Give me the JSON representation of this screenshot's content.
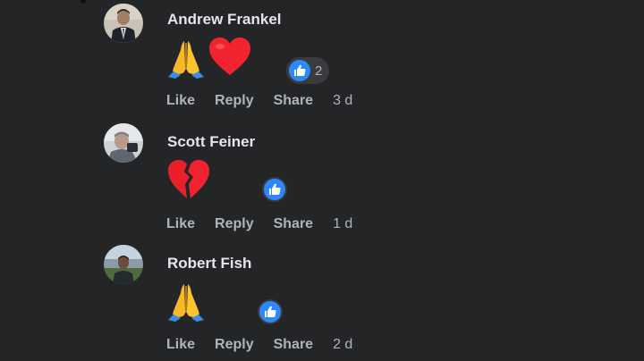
{
  "comments": [
    {
      "author": "Andrew Frankel",
      "emoji_names": [
        "folded-hands-icon",
        "red-heart-icon"
      ],
      "like_count": "2",
      "actions": {
        "like": "Like",
        "reply": "Reply",
        "share": "Share"
      },
      "time": "3 d"
    },
    {
      "author": "Scott Feiner",
      "emoji_names": [
        "broken-heart-icon"
      ],
      "like_count": "",
      "actions": {
        "like": "Like",
        "reply": "Reply",
        "share": "Share"
      },
      "time": "1 d"
    },
    {
      "author": "Robert Fish",
      "emoji_names": [
        "folded-hands-icon"
      ],
      "like_count": "",
      "actions": {
        "like": "Like",
        "reply": "Reply",
        "share": "Share"
      },
      "time": "2 d"
    }
  ],
  "colors": {
    "background": "#242526",
    "name_text": "#e4e6eb",
    "meta_text": "#b0b3b8",
    "like_blue": "#2d88ff",
    "heart_red": "#f0232e"
  }
}
